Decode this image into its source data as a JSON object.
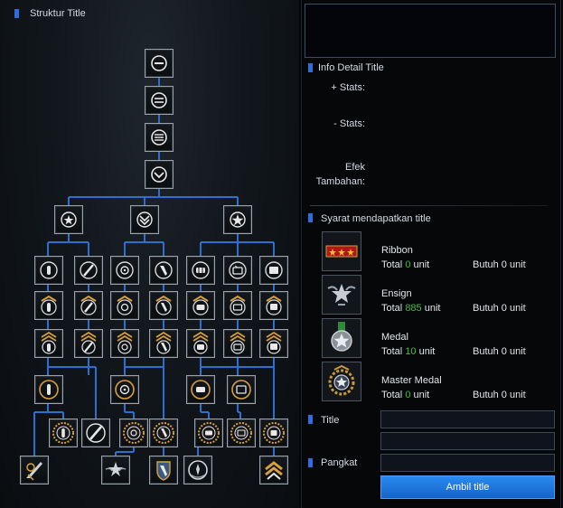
{
  "left": {
    "title": "Struktur Title"
  },
  "info": {
    "title": "Info Detail Title",
    "plus_stats": "+ Stats:",
    "minus_stats": "- Stats:",
    "effect_line1": "Efek",
    "effect_line2": "Tambahan:"
  },
  "requirements": {
    "title": "Syarat mendapatkan title",
    "items": [
      {
        "name": "Ribbon",
        "total_label": "Total",
        "total_value": "0",
        "unit": "unit",
        "need": "Butuh 0 unit",
        "icon": "ribbon-icon"
      },
      {
        "name": "Ensign",
        "total_label": "Total",
        "total_value": "885",
        "unit": "unit",
        "need": "Butuh 0 unit",
        "icon": "ensign-icon"
      },
      {
        "name": "Medal",
        "total_label": "Total",
        "total_value": "10",
        "unit": "unit",
        "need": "Butuh 0 unit",
        "icon": "medal-icon"
      },
      {
        "name": "Master Medal",
        "total_label": "Total",
        "total_value": "0",
        "unit": "unit",
        "need": "Butuh 0 unit",
        "icon": "master-medal-icon"
      }
    ]
  },
  "form": {
    "title_label": "Title",
    "rank_label": "Pangkat",
    "title_value_1": "",
    "title_value_2": "",
    "rank_value": "",
    "submit_label": "Ambil title"
  },
  "colors": {
    "accent": "#2c6de0",
    "positive": "#3ec23e",
    "button": "#1f78e0"
  }
}
